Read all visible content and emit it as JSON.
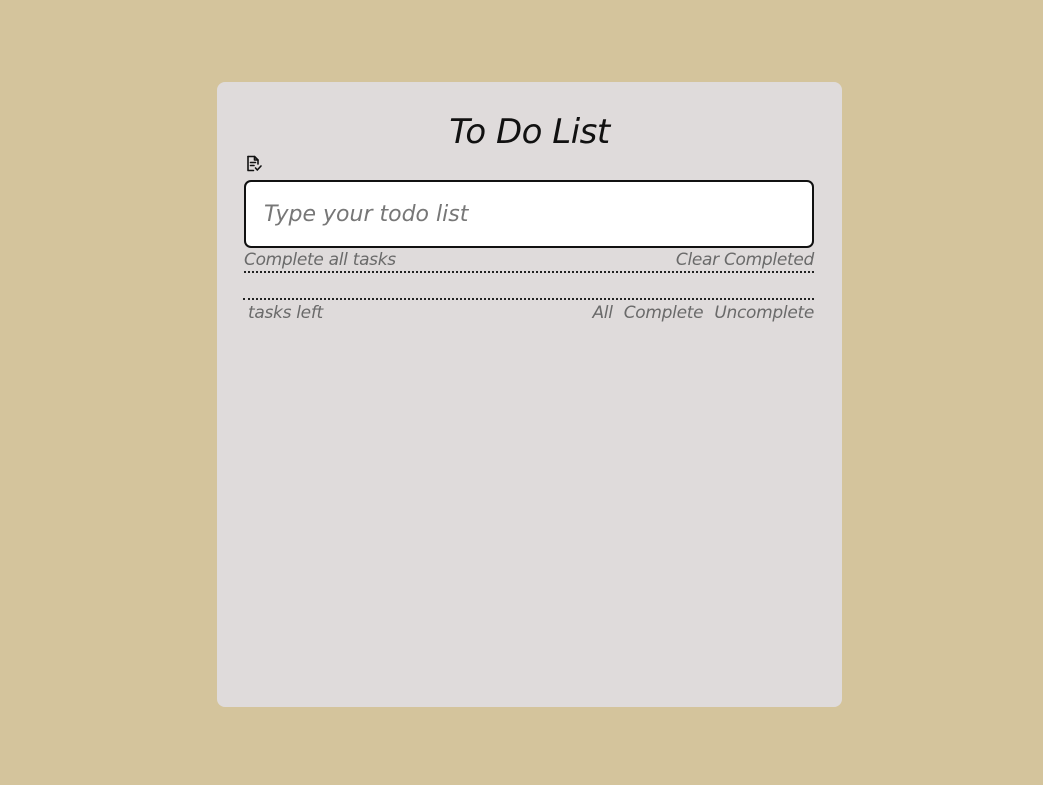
{
  "app": {
    "title": "To Do List"
  },
  "icons": {
    "note": "note-check-icon"
  },
  "input": {
    "placeholder": "Type your todo list",
    "value": ""
  },
  "actions": {
    "complete_all": "Complete all tasks",
    "clear_completed": "Clear Completed"
  },
  "footer": {
    "tasks_left": "tasks left",
    "filters": [
      "All",
      "Complete",
      "Uncomplete"
    ]
  },
  "colors": {
    "background": "#d4c49c",
    "card": "#dfdbdb",
    "input_border": "#111111",
    "muted_text": "#6a6a6a"
  }
}
